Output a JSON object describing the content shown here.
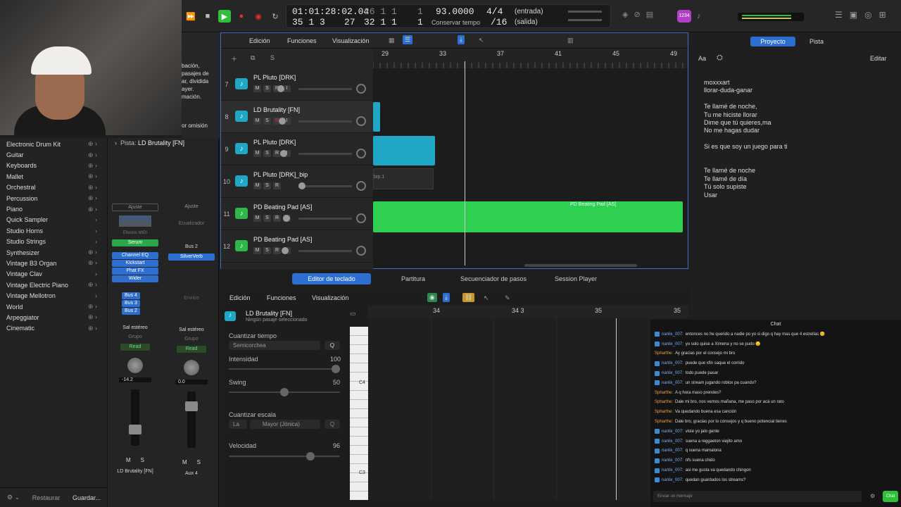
{
  "transport": {
    "time": "01:01:28:02.04",
    "bars_top": "26  1  1",
    "bars_top2": "1",
    "bars_bottom": "35  1  3",
    "bars_bottom2": "27",
    "bars_bottom3": "32  1  1",
    "bars_bottom4": "1",
    "tempo": "93.0000",
    "tempo_label": "Conservar tempo",
    "sig_top": "4/4",
    "sig_bottom": "/16",
    "input": "(entrada)",
    "output": "(salida)",
    "badge": "1234"
  },
  "library": {
    "items": [
      {
        "label": "Electronic Drum Kit",
        "ctrl": "⊕ ›"
      },
      {
        "label": "Guitar",
        "ctrl": "⊕ ›"
      },
      {
        "label": "Keyboards",
        "ctrl": "⊕ ›"
      },
      {
        "label": "Mallet",
        "ctrl": "⊕ ›"
      },
      {
        "label": "Orchestral",
        "ctrl": "⊕ ›"
      },
      {
        "label": "Percussion",
        "ctrl": "⊕ ›"
      },
      {
        "label": "Piano",
        "ctrl": "⊕ ›"
      },
      {
        "label": "Quick Sampler",
        "ctrl": "›"
      },
      {
        "label": "Studio Horns",
        "ctrl": "›"
      },
      {
        "label": "Studio Strings",
        "ctrl": "›"
      },
      {
        "label": "Synthesizer",
        "ctrl": "⊕ ›"
      },
      {
        "label": "Vintage B3 Organ",
        "ctrl": "⊕ ›"
      },
      {
        "label": "Vintage Clav",
        "ctrl": "›"
      },
      {
        "label": "Vintage Electric Piano",
        "ctrl": "⊕ ›"
      },
      {
        "label": "Vintage Mellotron",
        "ctrl": "›"
      },
      {
        "label": "World",
        "ctrl": "⊕ ›"
      },
      {
        "label": "Arpeggiator",
        "ctrl": "⊕ ›"
      },
      {
        "label": "Cinematic",
        "ctrl": "⊕ ›"
      }
    ],
    "restore": "Restaurar",
    "save": "Guardar..."
  },
  "webcam_overlay": {
    "line1": "bación,",
    "line2": "pasajes de",
    "line3": "ar, dividida",
    "line4": "ayer.",
    "line5": "mación.",
    "line6": "or omisión"
  },
  "inspector": {
    "header_prefix": "Pista:",
    "header_track": "LD Brutality [FN]",
    "strip1": {
      "ajuste": "Ajuste",
      "midi": "Efectos MIDI",
      "instrument": "Serum",
      "plugins": [
        "Channel EQ",
        "Kickstart",
        "Phat FX",
        "Wider"
      ],
      "sends": [
        "Bus 4",
        "Bus 3",
        "Bus 2"
      ],
      "output": "Sal estéreo",
      "group": "Grupo",
      "mode": "Read",
      "value": "-14.2",
      "m": "M",
      "s": "S",
      "name": "LD Brutality [FN]"
    },
    "strip2": {
      "ajuste": "Ajuste",
      "eq": "Ecualizador",
      "bus": "Bus 2",
      "plugin": "SilverVerb",
      "sends": "Envíos",
      "output": "Sal estéreo",
      "group": "Grupo",
      "mode": "Read",
      "value": "0.0",
      "m": "M",
      "s": "S",
      "name": "Aux 4"
    }
  },
  "main_menu": {
    "edit": "Edición",
    "functions": "Funciones",
    "view": "Visualización"
  },
  "ruler": [
    "29",
    "33",
    "37",
    "41",
    "45",
    "49"
  ],
  "tracks": [
    {
      "num": "7",
      "name": "PL Pluto [DRK]"
    },
    {
      "num": "8",
      "name": "LD Brutality [FN]"
    },
    {
      "num": "9",
      "name": "PL Pluto [DRK]"
    },
    {
      "num": "10",
      "name": "PL Pluto [DRK]_bip"
    },
    {
      "num": "11",
      "name": "PD Beating Pad [AS]"
    },
    {
      "num": "12",
      "name": "PD Beating Pad [AS]"
    }
  ],
  "track_buttons": {
    "m": "M",
    "s": "S",
    "r": "R",
    "i": "I"
  },
  "region_label": "PD Beating Pad [AS]",
  "region_bip": "bip.1",
  "bottom_tabs": [
    "Editor de teclado",
    "Partitura",
    "Secuenciador de pasos",
    "Session Player"
  ],
  "piano_editor": {
    "region_name": "LD Brutality [FN]",
    "subtitle": "Ningún pasaje seleccionado",
    "quantize_label": "Cuantizar tiempo",
    "quantize_value": "Semicorchea",
    "intensity_label": "Intensidad",
    "intensity_value": "100",
    "swing_label": "Swing",
    "swing_value": "50",
    "scale_label": "Cuantizar escala",
    "scale_key": "La",
    "scale_mode": "Mayor (Jónica)",
    "velocity_label": "Velocidad",
    "velocity_value": "96",
    "q": "Q",
    "ruler": [
      "34",
      "34 3",
      "35",
      "35"
    ],
    "c4": "C4",
    "c3": "C3"
  },
  "right_panel": {
    "tab_project": "Proyecto",
    "tab_track": "Pista",
    "aa": "Aa",
    "edit": "Editar",
    "notes": [
      "moxxxart",
      "llorar-duda-ganar",
      "",
      "Te llamé de noche,",
      "Tu me hiciste llorar",
      "Dime que tú quieres,ma",
      "No me hagas dudar",
      "",
      "Si es que soy un juego para ti",
      "",
      "",
      "Te llamé de noche",
      "Te llamé de día",
      "Tú solo supiste",
      "Usar"
    ]
  },
  "chat": {
    "title": "Chat",
    "messages": [
      {
        "user": "nanlix_007:",
        "text": "entonces no he querido a nadie po yo si digo q hay mas que 4 estrellas 😊",
        "kind": "a"
      },
      {
        "user": "nanlix_007:",
        "text": "yo solo quise a Ximena y no se pudo 😔",
        "kind": "a"
      },
      {
        "user": "Spharthe:",
        "text": "Ay gracias por el consejo mi bro",
        "kind": "b"
      },
      {
        "user": "nanlix_007:",
        "text": "puede que xfin saque el corrido",
        "kind": "a"
      },
      {
        "user": "nanlix_007:",
        "text": "todo puede pasar",
        "kind": "a"
      },
      {
        "user": "nanlix_007:",
        "text": "un stream jugando roblox pa cuando?",
        "kind": "a"
      },
      {
        "user": "Spharthe:",
        "text": "A q hora maso prendes?",
        "kind": "b"
      },
      {
        "user": "Spharthe:",
        "text": "Dale mi bro, nos vemos mañana, me paso por acá un rato",
        "kind": "b"
      },
      {
        "user": "Spharthe:",
        "text": "Va quedando buena esa canción",
        "kind": "b"
      },
      {
        "user": "Spharthe:",
        "text": "Dale bro, gracias por lo consejos y q bueno potencial tienes",
        "kind": "b"
      },
      {
        "user": "nanlix_007:",
        "text": "viste yo jalo gente",
        "kind": "a"
      },
      {
        "user": "nanlix_007:",
        "text": "suena a reggaeton viejito amo",
        "kind": "a"
      },
      {
        "user": "nanlix_007:",
        "text": "q suena mamalona",
        "kind": "a"
      },
      {
        "user": "nanlix_007:",
        "text": "nfs suena chido",
        "kind": "a"
      },
      {
        "user": "nanlix_007:",
        "text": "asi me gusta va quedando chingon",
        "kind": "a"
      },
      {
        "user": "nanlix_007:",
        "text": "quedan guardados los streams?",
        "kind": "a"
      }
    ],
    "placeholder": "Enviar un mensaje",
    "send": "Chat"
  }
}
